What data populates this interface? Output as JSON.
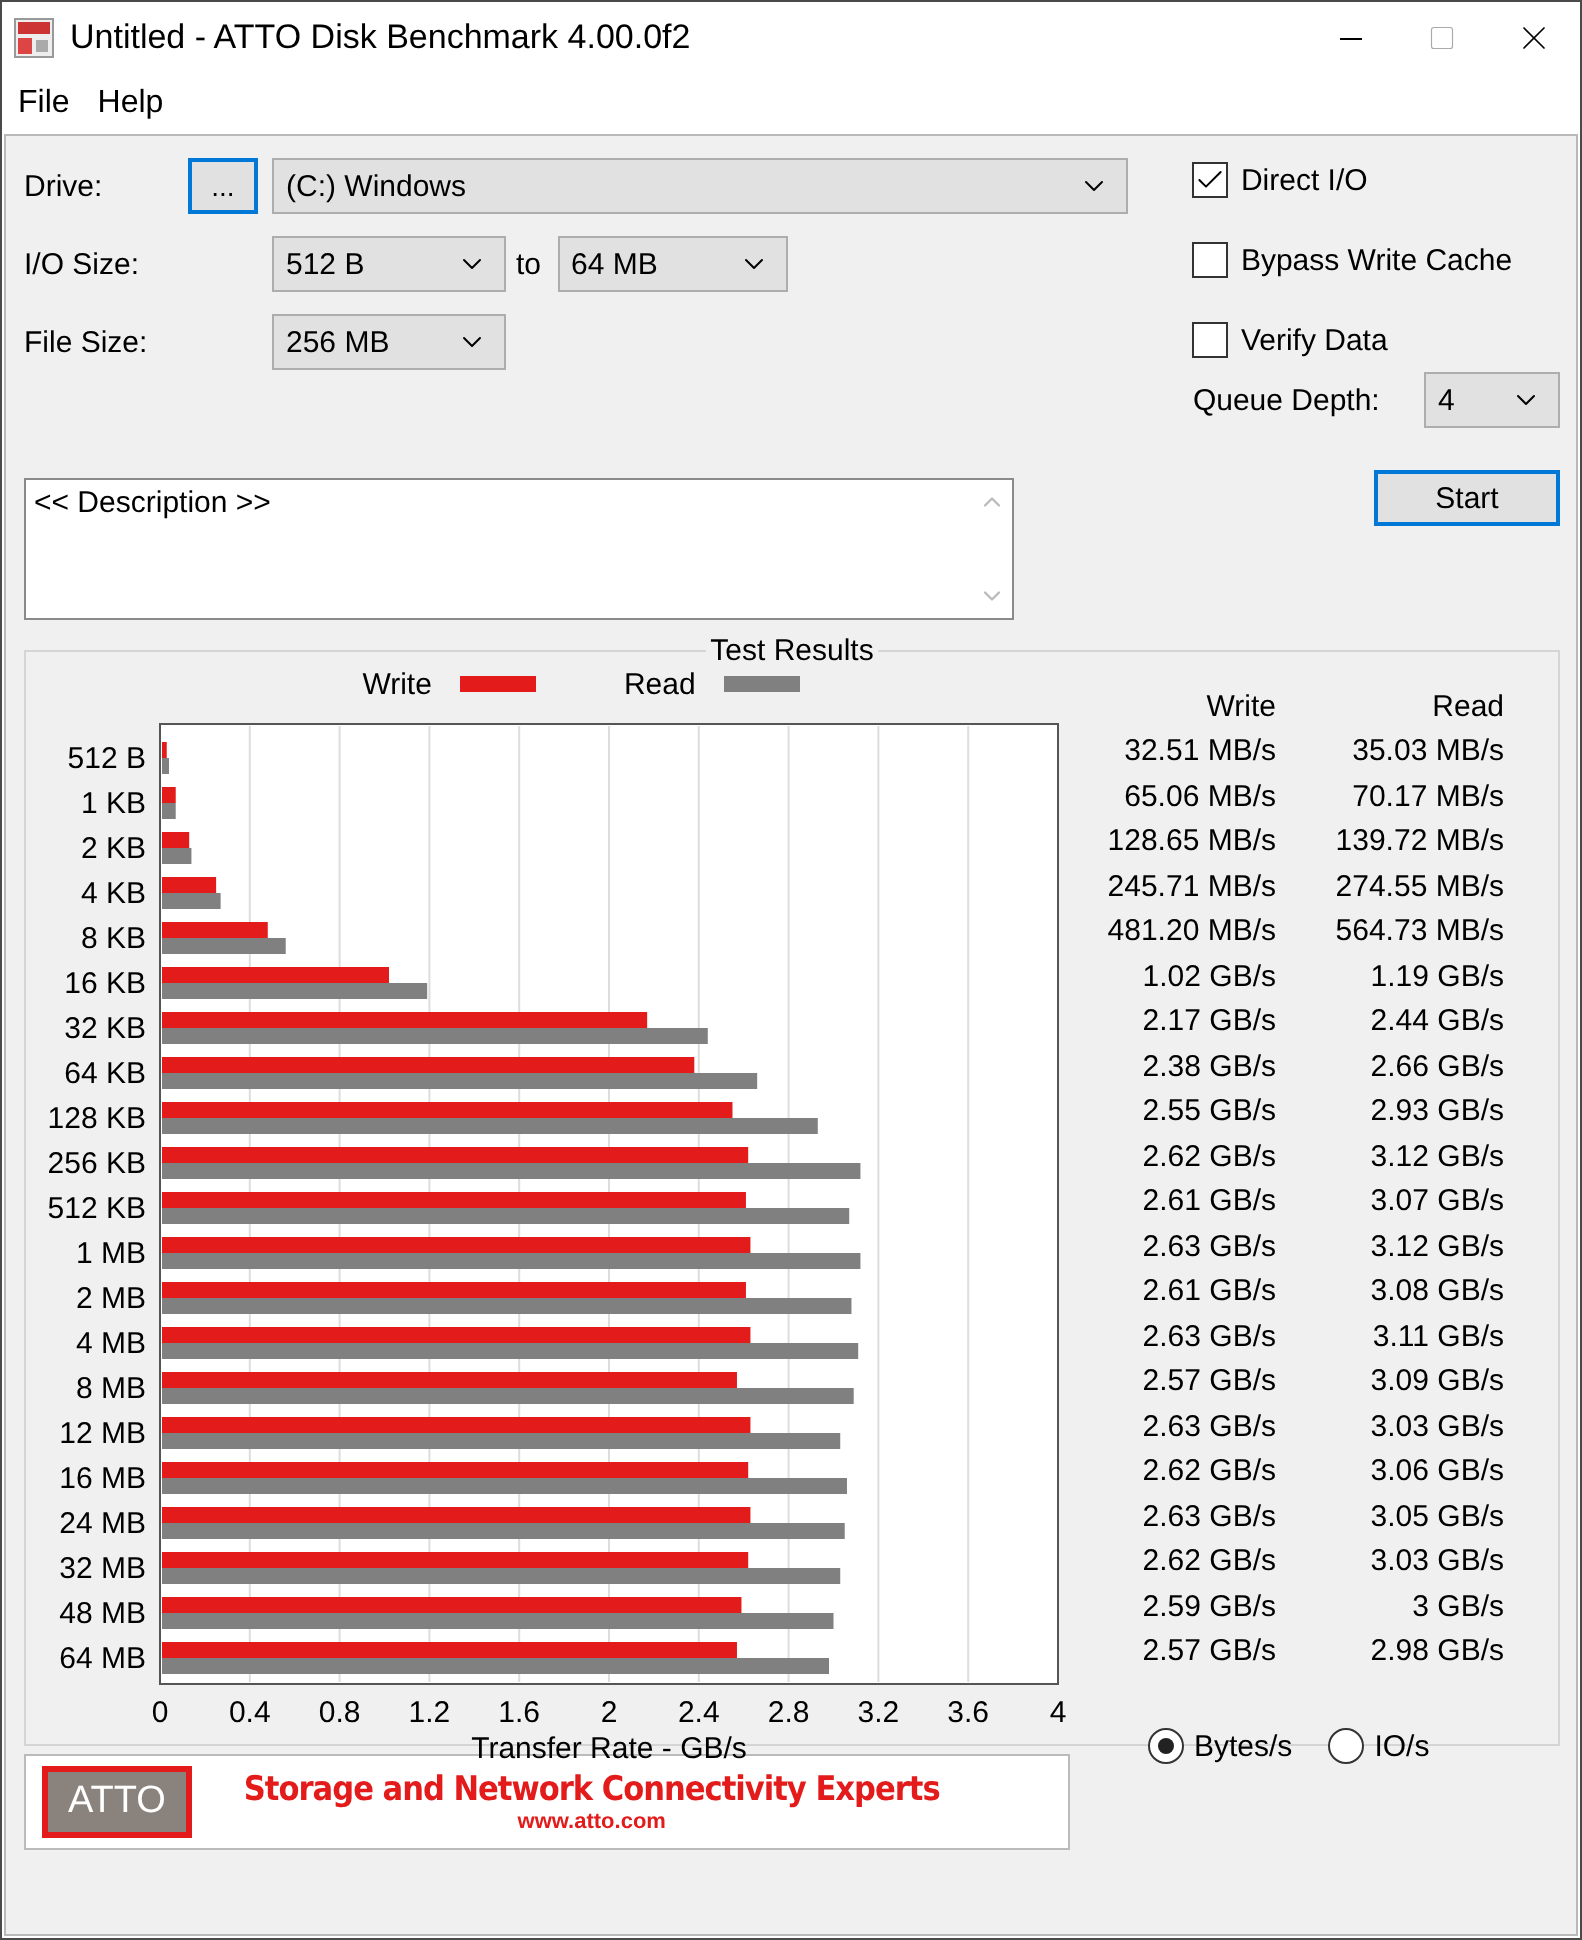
{
  "window": {
    "title": "Untitled - ATTO Disk Benchmark 4.00.0f2"
  },
  "menu": [
    "File",
    "Help"
  ],
  "drive": {
    "label": "Drive:",
    "browse": "...",
    "value": "(C:) Windows"
  },
  "io_size": {
    "label": "I/O Size:",
    "from": "512 B",
    "to_label": "to",
    "to": "64 MB"
  },
  "file_size": {
    "label": "File Size:",
    "value": "256 MB"
  },
  "description": {
    "value": "<< Description >>"
  },
  "options": [
    {
      "label": "Direct I/O",
      "checked": true
    },
    {
      "label": "Bypass Write Cache",
      "checked": false
    },
    {
      "label": "Verify Data",
      "checked": false
    }
  ],
  "queue_depth": {
    "label": "Queue Depth:",
    "value": "4"
  },
  "start_button": "Start",
  "results": {
    "title": "Test Results",
    "chart_data": {
      "type": "bar",
      "orientation": "horizontal",
      "xlabel": "Transfer Rate - GB/s",
      "categories": [
        "512 B",
        "1 KB",
        "2 KB",
        "4 KB",
        "8 KB",
        "16 KB",
        "32 KB",
        "64 KB",
        "128 KB",
        "256 KB",
        "512 KB",
        "1 MB",
        "2 MB",
        "4 MB",
        "8 MB",
        "12 MB",
        "16 MB",
        "24 MB",
        "32 MB",
        "48 MB",
        "64 MB"
      ],
      "xlim": [
        0,
        4
      ],
      "grid": true,
      "xticks": [
        0,
        0.4,
        0.8,
        1.2,
        1.6,
        2,
        2.4,
        2.8,
        3.2,
        3.6,
        4
      ],
      "series": [
        {
          "name": "Write",
          "color": "#e31b1b",
          "values": [
            0.03,
            0.07,
            0.13,
            0.25,
            0.48,
            1.02,
            2.17,
            2.38,
            2.55,
            2.62,
            2.61,
            2.63,
            2.61,
            2.63,
            2.57,
            2.63,
            2.62,
            2.63,
            2.62,
            2.59,
            2.57
          ]
        },
        {
          "name": "Read",
          "color": "#808080",
          "values": [
            0.04,
            0.07,
            0.14,
            0.27,
            0.56,
            1.19,
            2.44,
            2.66,
            2.93,
            3.12,
            3.07,
            3.12,
            3.08,
            3.11,
            3.09,
            3.03,
            3.06,
            3.05,
            3.03,
            3,
            2.98
          ]
        }
      ]
    },
    "table_headers": [
      "Write",
      "Read"
    ],
    "rows": [
      {
        "write": "32.51 MB/s",
        "read": "35.03 MB/s"
      },
      {
        "write": "65.06 MB/s",
        "read": "70.17 MB/s"
      },
      {
        "write": "128.65 MB/s",
        "read": "139.72 MB/s"
      },
      {
        "write": "245.71 MB/s",
        "read": "274.55 MB/s"
      },
      {
        "write": "481.20 MB/s",
        "read": "564.73 MB/s"
      },
      {
        "write": "1.02 GB/s",
        "read": "1.19 GB/s"
      },
      {
        "write": "2.17 GB/s",
        "read": "2.44 GB/s"
      },
      {
        "write": "2.38 GB/s",
        "read": "2.66 GB/s"
      },
      {
        "write": "2.55 GB/s",
        "read": "2.93 GB/s"
      },
      {
        "write": "2.62 GB/s",
        "read": "3.12 GB/s"
      },
      {
        "write": "2.61 GB/s",
        "read": "3.07 GB/s"
      },
      {
        "write": "2.63 GB/s",
        "read": "3.12 GB/s"
      },
      {
        "write": "2.61 GB/s",
        "read": "3.08 GB/s"
      },
      {
        "write": "2.63 GB/s",
        "read": "3.11 GB/s"
      },
      {
        "write": "2.57 GB/s",
        "read": "3.09 GB/s"
      },
      {
        "write": "2.63 GB/s",
        "read": "3.03 GB/s"
      },
      {
        "write": "2.62 GB/s",
        "read": "3.06 GB/s"
      },
      {
        "write": "2.63 GB/s",
        "read": "3.05 GB/s"
      },
      {
        "write": "2.62 GB/s",
        "read": "3.03 GB/s"
      },
      {
        "write": "2.59 GB/s",
        "read": "3 GB/s"
      },
      {
        "write": "2.57 GB/s",
        "read": "2.98 GB/s"
      }
    ],
    "units": [
      {
        "label": "Bytes/s",
        "selected": true
      },
      {
        "label": "IO/s",
        "selected": false
      }
    ]
  },
  "banner": {
    "logo": "ATTO",
    "tagline": "Storage and Network Connectivity Experts",
    "url": "www.atto.com"
  }
}
